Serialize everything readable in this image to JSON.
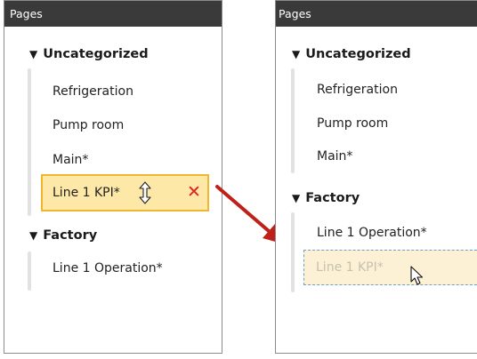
{
  "left_panel": {
    "header": "Pages",
    "group1": {
      "title": "Uncategorized",
      "items": [
        "Refrigeration",
        "Pump room",
        "Main*"
      ]
    },
    "dragged_item": {
      "label": "Line 1 KPI*",
      "resize_icon": "vertical-resize-icon",
      "delete_icon": "close-icon",
      "delete_symbol": "✕"
    },
    "group2": {
      "title": "Factory",
      "items": [
        "Line 1 Operation*"
      ]
    }
  },
  "right_panel": {
    "header": "Pages",
    "group1": {
      "title": "Uncategorized",
      "items": [
        "Refrigeration",
        "Pump room",
        "Main*"
      ]
    },
    "group2": {
      "title": "Factory",
      "items": [
        "Line 1 Operation*"
      ]
    },
    "drop_placeholder": {
      "label": "Line 1 KPI*",
      "cursor_icon": "pointer-cursor-icon"
    }
  },
  "group_toggle_symbol": "▼",
  "colors": {
    "header_bg": "#3a3a3a",
    "drag_fill": "#fde8a8",
    "drag_border": "#f0b62e",
    "delete_x": "#e02020",
    "arrow": "#c0201a",
    "drop_border": "#6aa0d0"
  },
  "arrow_icon": "arrow-icon"
}
